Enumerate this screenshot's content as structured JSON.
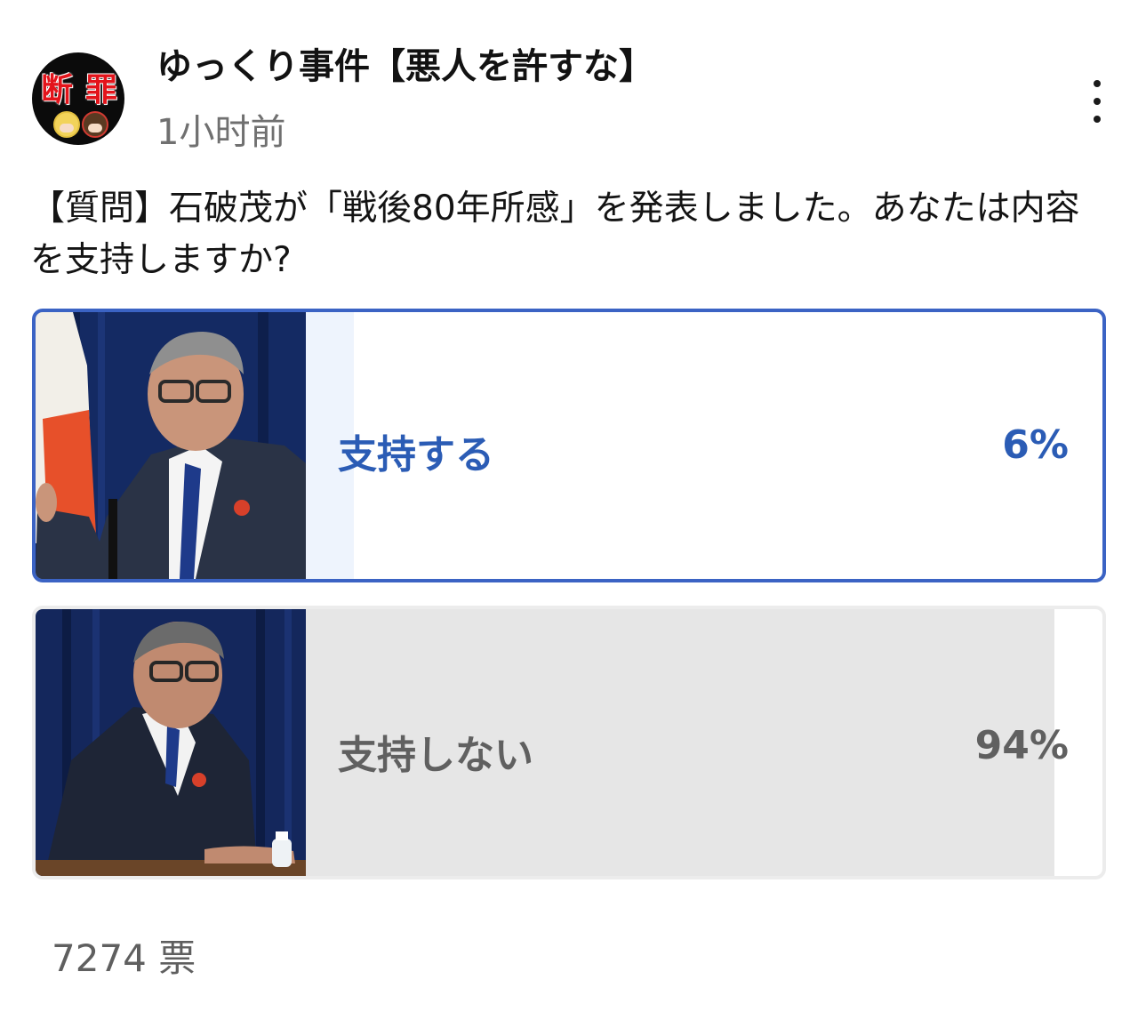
{
  "post": {
    "channel_name": "ゆっくり事件【悪人を許すな】",
    "time_ago": "1小时前",
    "avatar_text": [
      "断",
      "罪"
    ],
    "question": "【質問】石破茂が「戦後80年所感」を発表しました。あなたは内容を支持しますか?"
  },
  "poll": {
    "options": [
      {
        "label": "支持する",
        "percent_text": "6%",
        "percent": 6,
        "selected": true
      },
      {
        "label": "支持しない",
        "percent_text": "94%",
        "percent": 94,
        "selected": false
      }
    ],
    "votes_text": "7274 票"
  },
  "icons": {
    "more": "more-vertical-icon",
    "avatar": "channel-avatar"
  },
  "colors": {
    "accent": "#3b63c4",
    "selected_text": "#2b5cb5",
    "selected_fill": "#eef4fd",
    "result_fill": "#e6e6e6",
    "muted_text": "#606060"
  }
}
